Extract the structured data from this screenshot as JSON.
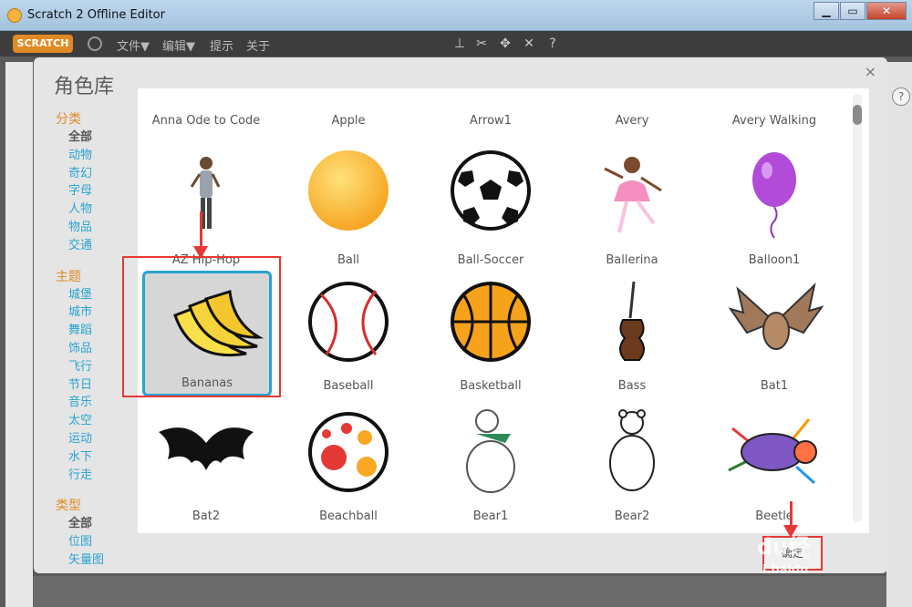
{
  "window": {
    "title": "Scratch 2 Offline Editor"
  },
  "menubar": {
    "logo": "SCRATCH",
    "items": [
      "文件▼",
      "编辑▼",
      "提示",
      "关于"
    ]
  },
  "dialog": {
    "title": "角色库",
    "close": "×",
    "categories": {
      "group_label": "分类",
      "items": [
        "全部",
        "动物",
        "奇幻",
        "字母",
        "人物",
        "物品",
        "交通"
      ],
      "active": 0
    },
    "themes": {
      "group_label": "主题",
      "items": [
        "城堡",
        "城市",
        "舞蹈",
        "饰品",
        "飞行",
        "节日",
        "音乐",
        "太空",
        "运动",
        "水下",
        "行走"
      ]
    },
    "types": {
      "group_label": "类型",
      "items": [
        "全部",
        "位图",
        "矢量图"
      ],
      "active": 0
    },
    "confirm_label": "确定"
  },
  "sprites_top_row": [
    "Anna Ode to Code",
    "Apple",
    "Arrow1",
    "Avery",
    "Avery Walking"
  ],
  "sprites": [
    [
      "AZ Hip-Hop",
      "Ball",
      "Ball-Soccer",
      "Ballerina",
      "Balloon1"
    ],
    [
      "Bananas",
      "Baseball",
      "Basketball",
      "Bass",
      "Bat1"
    ],
    [
      "Bat2",
      "Beachball",
      "Bear1",
      "Bear2",
      "Beetle"
    ]
  ],
  "selected_sprite": "Bananas",
  "watermark": {
    "brand": "du经",
    "site": "i.baidu"
  },
  "colors": {
    "accent": "#29a3cf",
    "group": "#e08a25",
    "annotation": "#e53935"
  }
}
